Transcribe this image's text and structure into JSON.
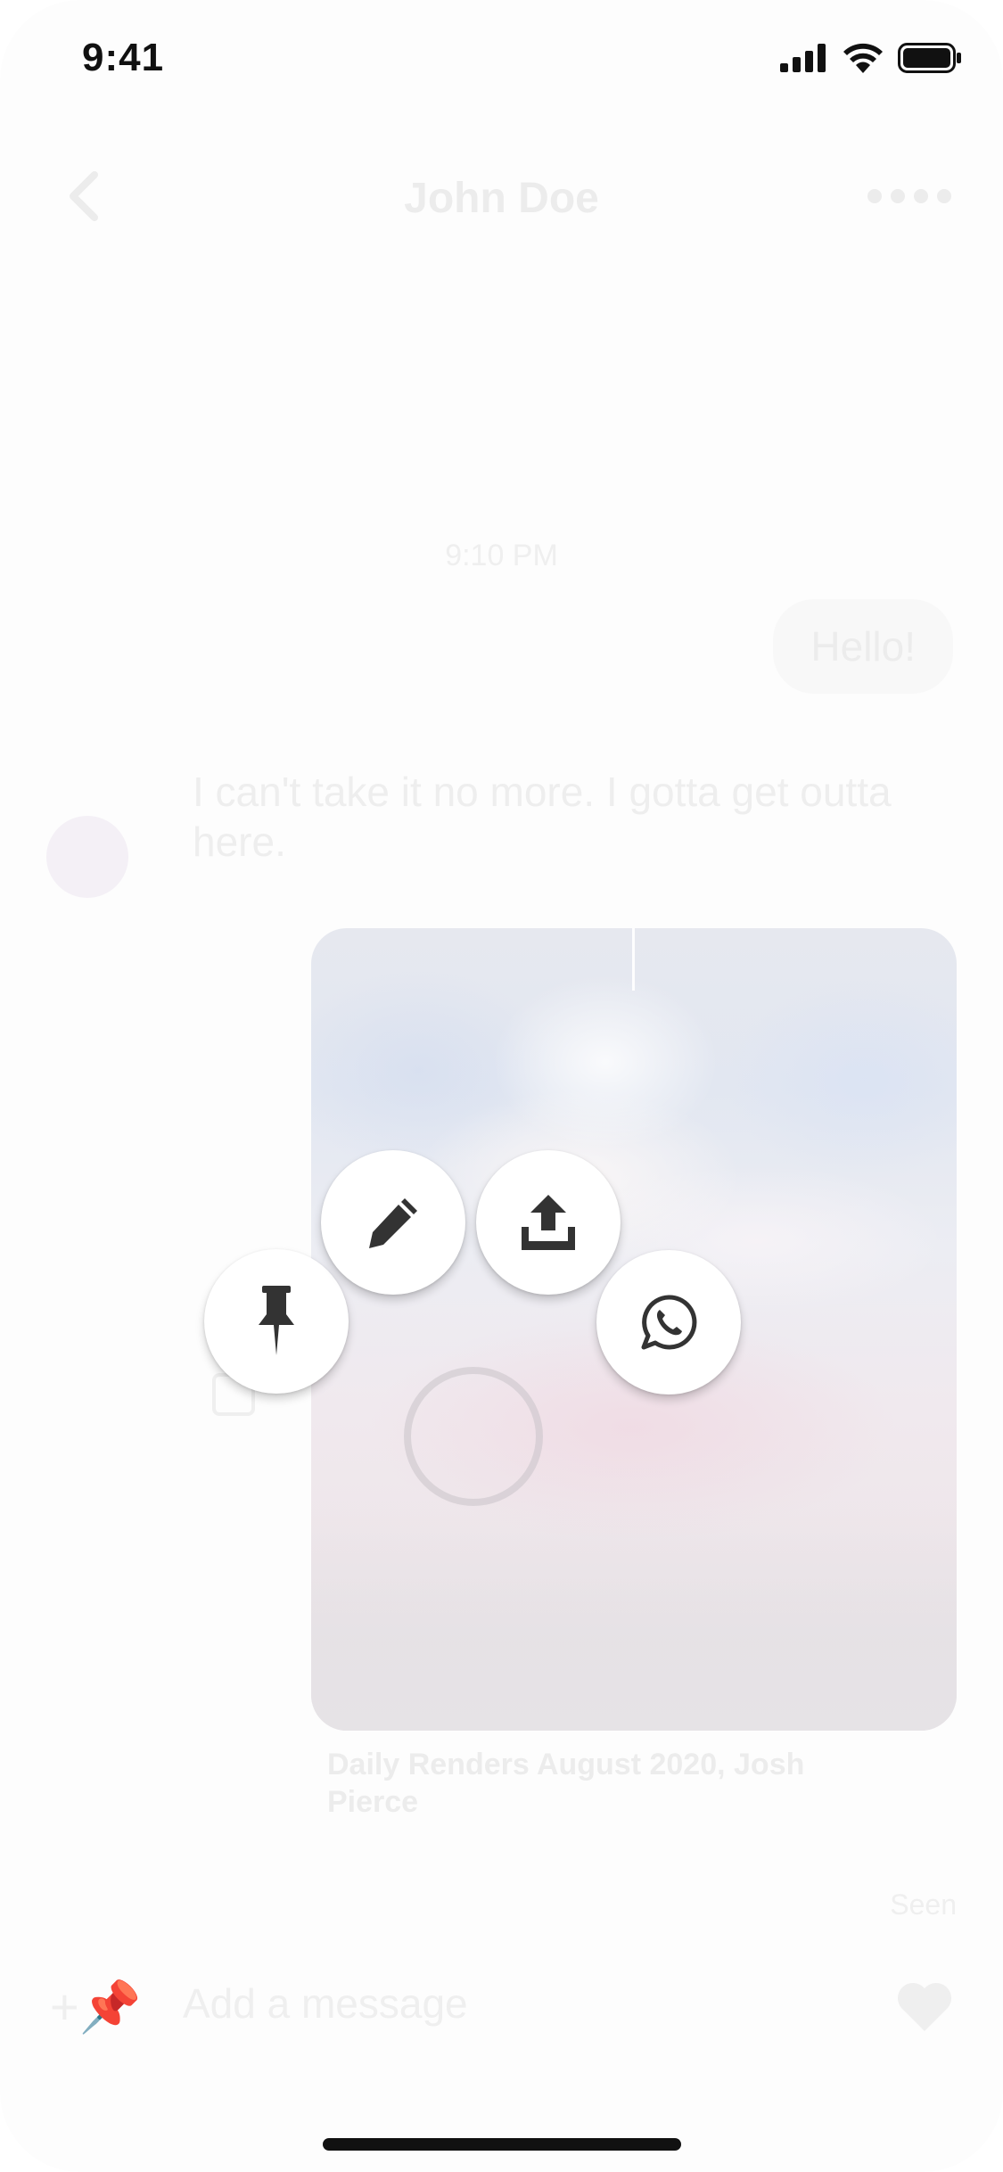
{
  "status_bar": {
    "time": "9:41"
  },
  "nav": {
    "title": "John Doe"
  },
  "conversation": {
    "timestamp": "9:10 PM",
    "outgoing_message": "Hello!",
    "incoming_message": "I can't take it no more. I gotta get outta here.",
    "photo_caption": "Daily Renders August 2020, Josh Pierce",
    "seen_label": "Seen"
  },
  "composer": {
    "placeholder": "Add a message"
  },
  "actions": [
    {
      "name": "pin",
      "icon": "pin-icon"
    },
    {
      "name": "edit",
      "icon": "pencil-icon"
    },
    {
      "name": "share",
      "icon": "share-upload-icon"
    },
    {
      "name": "whatsapp",
      "icon": "whatsapp-icon"
    }
  ],
  "colors": {
    "icon": "#333333",
    "faded_text": "#ececec",
    "background": "#fdfdfd"
  }
}
